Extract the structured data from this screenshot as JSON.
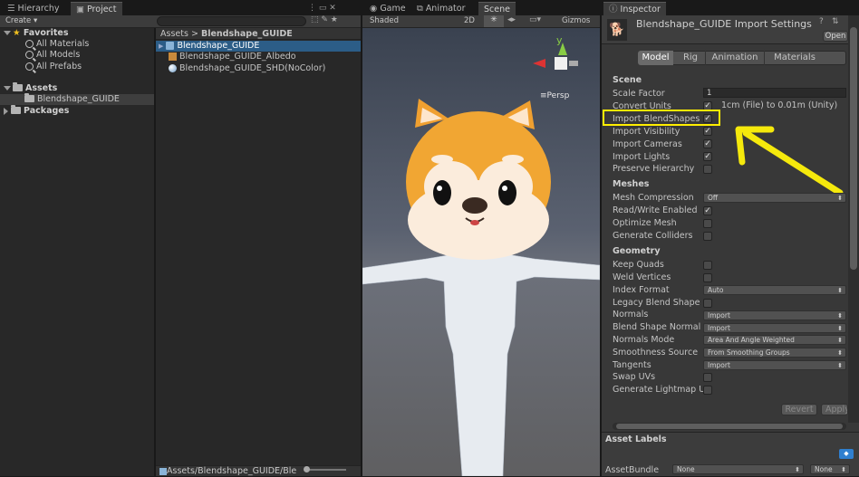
{
  "hierarchy_tab": "Hierarchy",
  "project_tab": "Project",
  "create_label": "Create",
  "favorites": {
    "title": "Favorites",
    "items": [
      "All Materials",
      "All Models",
      "All Prefabs"
    ]
  },
  "assets_tree": {
    "title": "Assets",
    "child": "Blendshape_GUIDE",
    "packages": "Packages"
  },
  "breadcrumb": {
    "root": "Assets",
    "sep": ">",
    "current": "Blendshape_GUIDE"
  },
  "files": [
    "Blendshape_GUIDE",
    "Blendshape_GUIDE_Albedo",
    "Blendshape_GUIDE_SHD(NoColor)"
  ],
  "project_path": "Assets/Blendshape_GUIDE/Ble",
  "scene_tabs": [
    "Game",
    "Animator",
    "Scene"
  ],
  "scene_toolbar": {
    "shading": "Shaded",
    "mode2d": "2D",
    "gizmos": "Gizmos"
  },
  "gizmo": {
    "y": "y",
    "x": "x",
    "persp": "Persp"
  },
  "inspector": {
    "tab": "Inspector",
    "title": "Blendshape_GUIDE Import Settings",
    "open_btn": "Open",
    "tabs": [
      "Model",
      "Rig",
      "Animation",
      "Materials"
    ],
    "scene_section": "Scene",
    "scale_factor_label": "Scale Factor",
    "scale_factor_value": "1",
    "convert_units_label": "Convert Units",
    "convert_units_note": "1cm (File) to 0.01m (Unity)",
    "import_blendshapes": "Import BlendShapes",
    "import_visibility": "Import Visibility",
    "import_cameras": "Import Cameras",
    "import_lights": "Import Lights",
    "preserve_hierarchy": "Preserve Hierarchy",
    "meshes_section": "Meshes",
    "mesh_compression_label": "Mesh Compression",
    "mesh_compression_value": "Off",
    "read_write": "Read/Write Enabled",
    "optimize_mesh": "Optimize Mesh",
    "generate_colliders": "Generate Colliders",
    "geometry_section": "Geometry",
    "keep_quads": "Keep Quads",
    "weld_vertices": "Weld Vertices",
    "index_format_label": "Index Format",
    "index_format_value": "Auto",
    "legacy_blend": "Legacy Blend Shape",
    "normals_label": "Normals",
    "normals_value": "Import",
    "blend_normals_label": "Blend Shape Normal",
    "blend_normals_value": "Import",
    "normals_mode_label": "Normals Mode",
    "normals_mode_value": "Area And Angle Weighted",
    "smoothness_label": "Smoothness Source",
    "smoothness_value": "From Smoothing Groups",
    "tangents_label": "Tangents",
    "tangents_value": "Import",
    "swap_uvs": "Swap UVs",
    "lightmap_uvs": "Generate Lightmap U",
    "revert_btn": "Revert",
    "apply_btn": "Apply",
    "asset_labels": "Asset Labels",
    "asset_bundle_label": "AssetBundle",
    "asset_bundle_value": "None",
    "asset_variant_value": "None"
  },
  "checkmark": "✓",
  "colors": {
    "highlight": "#ffee00",
    "selection": "#2c5d87",
    "arrow": "#f5e90c"
  }
}
